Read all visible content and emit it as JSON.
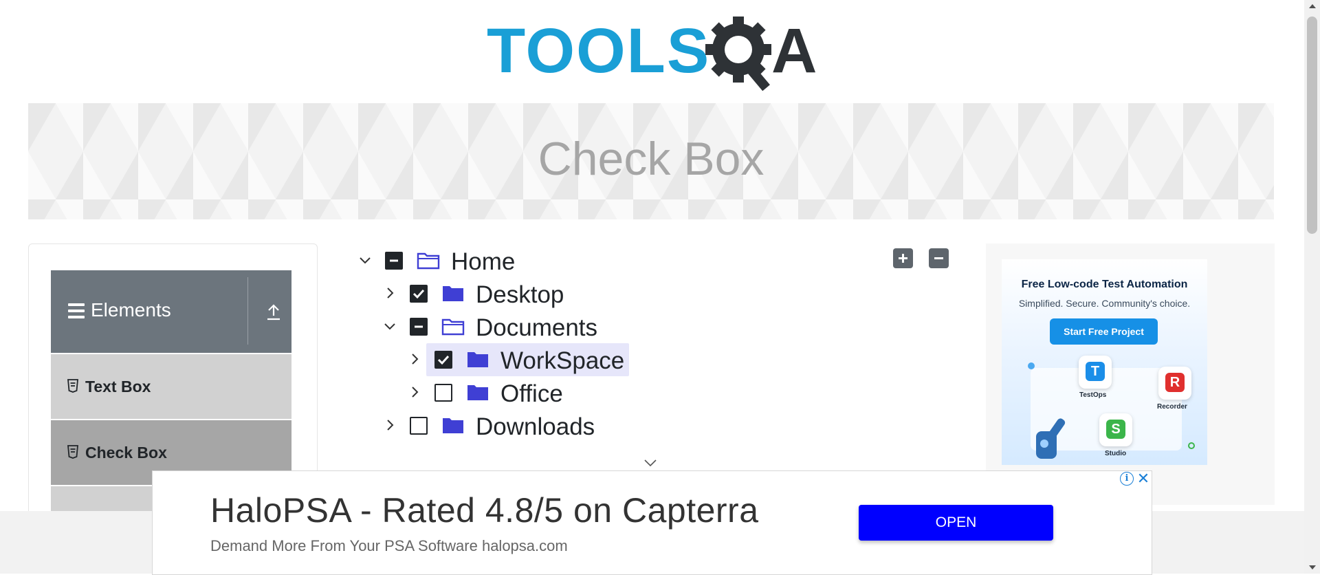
{
  "header": {
    "logo_text": "TOOLS",
    "logo_suffix": "A"
  },
  "banner": {
    "title": "Check Box"
  },
  "sidebar": {
    "group_label": "Elements",
    "items": [
      {
        "label": "Text Box",
        "active": false
      },
      {
        "label": "Check Box",
        "active": true
      }
    ]
  },
  "tree": [
    {
      "label": "Home",
      "expanded": true,
      "state": "half",
      "level": 0
    },
    {
      "label": "Desktop",
      "expanded": false,
      "state": "checked",
      "level": 1
    },
    {
      "label": "Documents",
      "expanded": true,
      "state": "half",
      "level": 1
    },
    {
      "label": "WorkSpace",
      "expanded": false,
      "state": "checked",
      "level": 2,
      "highlighted": true
    },
    {
      "label": "Office",
      "expanded": false,
      "state": "unchecked",
      "level": 2
    },
    {
      "label": "Downloads",
      "expanded": false,
      "state": "unchecked",
      "level": 1
    }
  ],
  "tree_controls": {
    "expand_all": "+",
    "collapse_all": "−"
  },
  "side_ad": {
    "title": "Free Low-code Test Automation",
    "subtitle": "Simplified. Secure. Community's choice.",
    "cta": "Start Free Project",
    "tiles": [
      "TestOps",
      "Recorder",
      "Studio"
    ]
  },
  "bottom_ad": {
    "headline": "HaloPSA - Rated 4.8/5 on Capterra",
    "subtext": "Demand More From Your PSA Software halopsa.com",
    "button": "OPEN"
  },
  "colors": {
    "logo_blue": "#1a9fd6",
    "logo_dark": "#2e3236",
    "folder_blue": "#3f3fd4",
    "sidebar_header": "#6c757d",
    "ad_button": "#0000ff"
  }
}
